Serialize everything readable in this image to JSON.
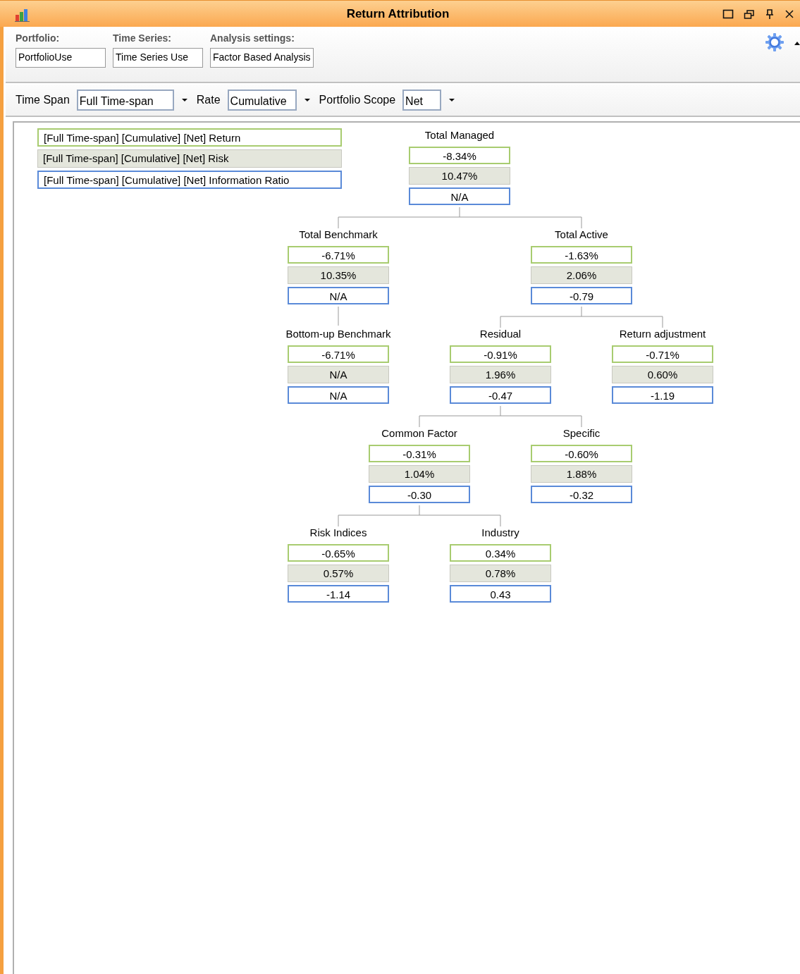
{
  "window": {
    "title": "Return Attribution"
  },
  "header": {
    "fields": [
      {
        "label": "Portfolio:",
        "value": "PortfolioUse"
      },
      {
        "label": "Time Series:",
        "value": "Time Series Use"
      },
      {
        "label": "Analysis settings:",
        "value": "Factor Based Analysis"
      }
    ]
  },
  "toolbar": [
    {
      "label": "Time Span",
      "value": "Full Time-span"
    },
    {
      "label": "Rate",
      "value": "Cumulative"
    },
    {
      "label": "Portfolio Scope",
      "value": "Net"
    }
  ],
  "legend": [
    {
      "kind": "return",
      "text": "[Full Time-span] [Cumulative] [Net] Return"
    },
    {
      "kind": "risk",
      "text": "[Full Time-span] [Cumulative] [Net] Risk"
    },
    {
      "kind": "ratio",
      "text": "[Full Time-span] [Cumulative] [Net] Information Ratio"
    }
  ],
  "tree": {
    "name": "Total Managed",
    "values": [
      "-8.34%",
      "10.47%",
      "N/A"
    ],
    "children": [
      {
        "name": "Total Benchmark",
        "values": [
          "-6.71%",
          "10.35%",
          "N/A"
        ],
        "children": [
          {
            "name": "Bottom-up Benchmark",
            "values": [
              "-6.71%",
              "N/A",
              "N/A"
            ]
          }
        ]
      },
      {
        "name": "Total Active",
        "values": [
          "-1.63%",
          "2.06%",
          "-0.79"
        ],
        "children": [
          {
            "name": "Residual",
            "values": [
              "-0.91%",
              "1.96%",
              "-0.47"
            ],
            "children": [
              {
                "name": "Common Factor",
                "values": [
                  "-0.31%",
                  "1.04%",
                  "-0.30"
                ],
                "children": [
                  {
                    "name": "Risk Indices",
                    "values": [
                      "-0.65%",
                      "0.57%",
                      "-1.14"
                    ]
                  },
                  {
                    "name": "Industry",
                    "values": [
                      "0.34%",
                      "0.78%",
                      "0.43"
                    ]
                  }
                ]
              },
              {
                "name": "Specific",
                "values": [
                  "-0.60%",
                  "1.88%",
                  "-0.32"
                ]
              }
            ]
          },
          {
            "name": "Return adjustment",
            "values": [
              "-0.71%",
              "0.60%",
              "-1.19"
            ]
          }
        ]
      }
    ]
  }
}
